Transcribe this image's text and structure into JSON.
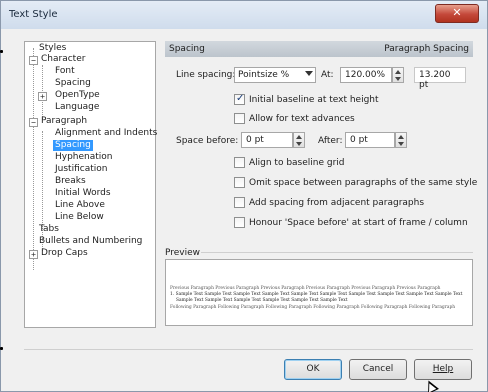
{
  "window": {
    "title": "Text Style",
    "close_icon": "close-icon"
  },
  "tree": {
    "items": [
      {
        "label": "Styles",
        "level": 0,
        "selected": false
      },
      {
        "label": "Character",
        "level": 0,
        "expander": "−",
        "selected": false
      },
      {
        "label": "Font",
        "level": 1,
        "selected": false
      },
      {
        "label": "Spacing",
        "level": 1,
        "selected": false
      },
      {
        "label": "OpenType",
        "level": 1,
        "expander": "+",
        "selected": false
      },
      {
        "label": "Language",
        "level": 1,
        "selected": false
      },
      {
        "label": "Paragraph",
        "level": 0,
        "expander": "−",
        "selected": false
      },
      {
        "label": "Alignment and Indents",
        "level": 1,
        "selected": false
      },
      {
        "label": "Spacing",
        "level": 1,
        "selected": true
      },
      {
        "label": "Hyphenation",
        "level": 1,
        "selected": false
      },
      {
        "label": "Justification",
        "level": 1,
        "selected": false
      },
      {
        "label": "Breaks",
        "level": 1,
        "selected": false
      },
      {
        "label": "Initial Words",
        "level": 1,
        "selected": false
      },
      {
        "label": "Line Above",
        "level": 1,
        "selected": false
      },
      {
        "label": "Line Below",
        "level": 1,
        "selected": false
      },
      {
        "label": "Tabs",
        "level": 0,
        "selected": false
      },
      {
        "label": "Bullets and Numbering",
        "level": 0,
        "selected": false
      },
      {
        "label": "Drop Caps",
        "level": 0,
        "expander": "+",
        "selected": false
      }
    ]
  },
  "section": {
    "title": "Spacing",
    "right_label": "Paragraph Spacing"
  },
  "line_spacing": {
    "label": "Line spacing:",
    "select_value": "Pointsize %",
    "at_label": "At:",
    "value": "120.00%",
    "readonly_value": "13.200 pt"
  },
  "checkboxes": {
    "initial_baseline": {
      "label": "Initial baseline at text height",
      "checked": true
    },
    "allow_advances": {
      "label": "Allow for text advances",
      "checked": false
    },
    "align_grid": {
      "label": "Align to baseline grid",
      "checked": false
    },
    "omit_space": {
      "label": "Omit space between paragraphs of the same style",
      "checked": false
    },
    "add_spacing": {
      "label": "Add spacing from adjacent paragraphs",
      "checked": false
    },
    "honour_space": {
      "label": "Honour 'Space before' at start of frame / column",
      "checked": false
    }
  },
  "space_before": {
    "label": "Space before:",
    "value": "0 pt"
  },
  "space_after": {
    "label": "After:",
    "value": "0 pt"
  },
  "preview": {
    "label": "Preview",
    "line1": "Previous Paragraph Previous Paragraph Previous Paragraph Previous Paragraph Previous Paragraph Previous Paragraph",
    "line2": "1. Sample Text Sample Text Sample Text Sample Text Sample Text Sample Text Sample Text Sample Text Sample Text Sample Text",
    "line3": "Sample Text Sample Text Sample Text Sample Text Sample Text Sample Text",
    "line4": "Following Paragraph Following Paragraph Following Paragraph Following Paragraph Following Paragraph Following Paragraph"
  },
  "buttons": {
    "ok": "OK",
    "cancel": "Cancel",
    "help": "Help"
  },
  "colors": {
    "selection": "#3399ff",
    "close_button": "#c4483a"
  }
}
